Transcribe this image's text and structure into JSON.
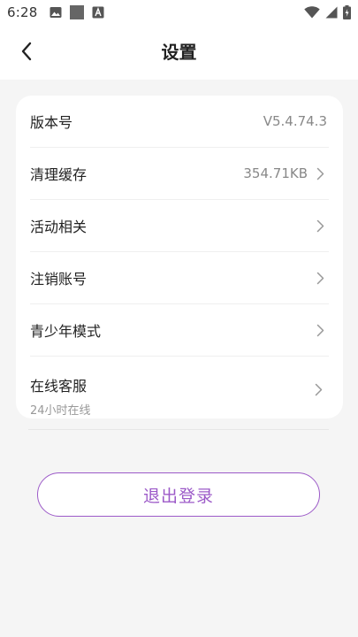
{
  "status_bar": {
    "time": "6:28",
    "left_icons": [
      "image-icon",
      "square-icon",
      "font-icon"
    ],
    "right_icons": [
      "wifi-icon",
      "signal-icon",
      "battery-icon"
    ]
  },
  "header": {
    "title": "设置",
    "back_icon": "chevron-left-icon"
  },
  "settings": {
    "items": [
      {
        "label": "版本号",
        "value": "V5.4.74.3",
        "chevron": false
      },
      {
        "label": "清理缓存",
        "value": "354.71KB",
        "chevron": true
      },
      {
        "label": "活动相关",
        "value": "",
        "chevron": true
      },
      {
        "label": "注销账号",
        "value": "",
        "chevron": true
      },
      {
        "label": "青少年模式",
        "value": "",
        "chevron": true
      },
      {
        "label": "在线客服",
        "sublabel": "24小时在线",
        "value": "",
        "chevron": true
      }
    ]
  },
  "logout": {
    "label": "退出登录"
  },
  "colors": {
    "accent": "#9c5ac8",
    "background": "#f5f5f5",
    "card": "#ffffff"
  }
}
